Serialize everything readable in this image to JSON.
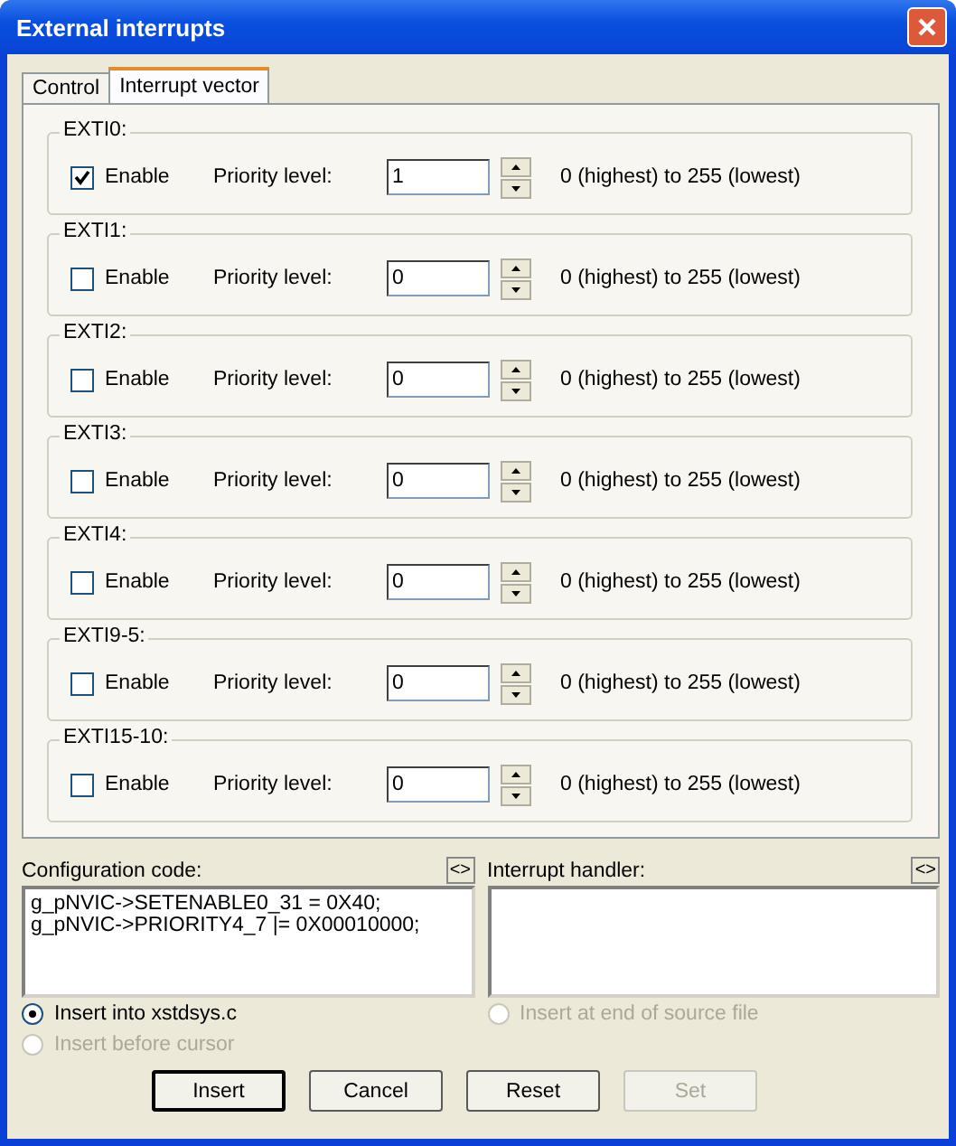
{
  "window": {
    "title": "External interrupts"
  },
  "tabs": [
    {
      "label": "Control",
      "selected": false
    },
    {
      "label": "Interrupt vector",
      "selected": true
    }
  ],
  "groups": [
    {
      "title": "EXTI0:",
      "enable_label": "Enable",
      "enabled": true,
      "priority_label": "Priority level:",
      "priority": "1",
      "range": "0 (highest) to 255 (lowest)"
    },
    {
      "title": "EXTI1:",
      "enable_label": "Enable",
      "enabled": false,
      "priority_label": "Priority level:",
      "priority": "0",
      "range": "0 (highest) to 255 (lowest)"
    },
    {
      "title": "EXTI2:",
      "enable_label": "Enable",
      "enabled": false,
      "priority_label": "Priority level:",
      "priority": "0",
      "range": "0 (highest) to 255 (lowest)"
    },
    {
      "title": "EXTI3:",
      "enable_label": "Enable",
      "enabled": false,
      "priority_label": "Priority level:",
      "priority": "0",
      "range": "0 (highest) to 255 (lowest)"
    },
    {
      "title": "EXTI4:",
      "enable_label": "Enable",
      "enabled": false,
      "priority_label": "Priority level:",
      "priority": "0",
      "range": "0 (highest) to 255 (lowest)"
    },
    {
      "title": "EXTI9-5:",
      "enable_label": "Enable",
      "enabled": false,
      "priority_label": "Priority level:",
      "priority": "0",
      "range": "0 (highest) to 255 (lowest)"
    },
    {
      "title": "EXTI15-10:",
      "enable_label": "Enable",
      "enabled": false,
      "priority_label": "Priority level:",
      "priority": "0",
      "range": "0 (highest) to 255 (lowest)"
    }
  ],
  "code_panes": [
    {
      "label": "Configuration code:",
      "expand": "<>",
      "lines": [
        "g_pNVIC->SETENABLE0_31 = 0X40;",
        "g_pNVIC->PRIORITY4_7 |= 0X00010000;"
      ],
      "options": [
        {
          "label": "Insert into xstdsys.c",
          "selected": true,
          "disabled": false
        },
        {
          "label": "Insert before cursor",
          "selected": false,
          "disabled": true
        }
      ]
    },
    {
      "label": "Interrupt handler:",
      "expand": "<>",
      "options": [
        {
          "label": "Insert at end of source file",
          "selected": false,
          "disabled": true
        }
      ]
    }
  ],
  "buttons": [
    {
      "label": "Insert",
      "default": true,
      "disabled": false
    },
    {
      "label": "Cancel",
      "default": false,
      "disabled": false
    },
    {
      "label": "Reset",
      "default": false,
      "disabled": false
    },
    {
      "label": "Set",
      "default": false,
      "disabled": true
    }
  ]
}
